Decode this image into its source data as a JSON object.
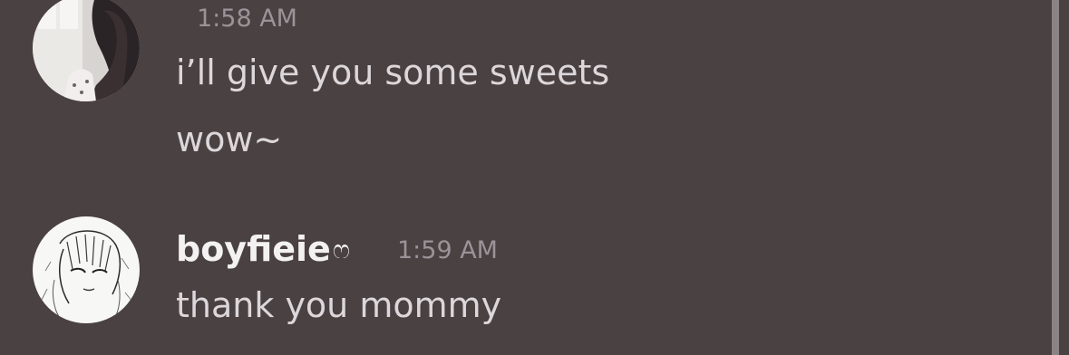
{
  "messages": [
    {
      "timestamp": "1:58 AM",
      "lines": [
        "i’ll give you some sweets",
        "wow~"
      ]
    },
    {
      "username": "boyfieie",
      "badge": "ෆ",
      "timestamp": "1:59 AM",
      "lines": [
        "thank you mommy"
      ]
    }
  ],
  "colors": {
    "background": "#4a4142",
    "text": "#dcd7da",
    "username": "#f4f1f2",
    "timestamp": "#9b9398",
    "scrollbar": "#8b8486"
  }
}
